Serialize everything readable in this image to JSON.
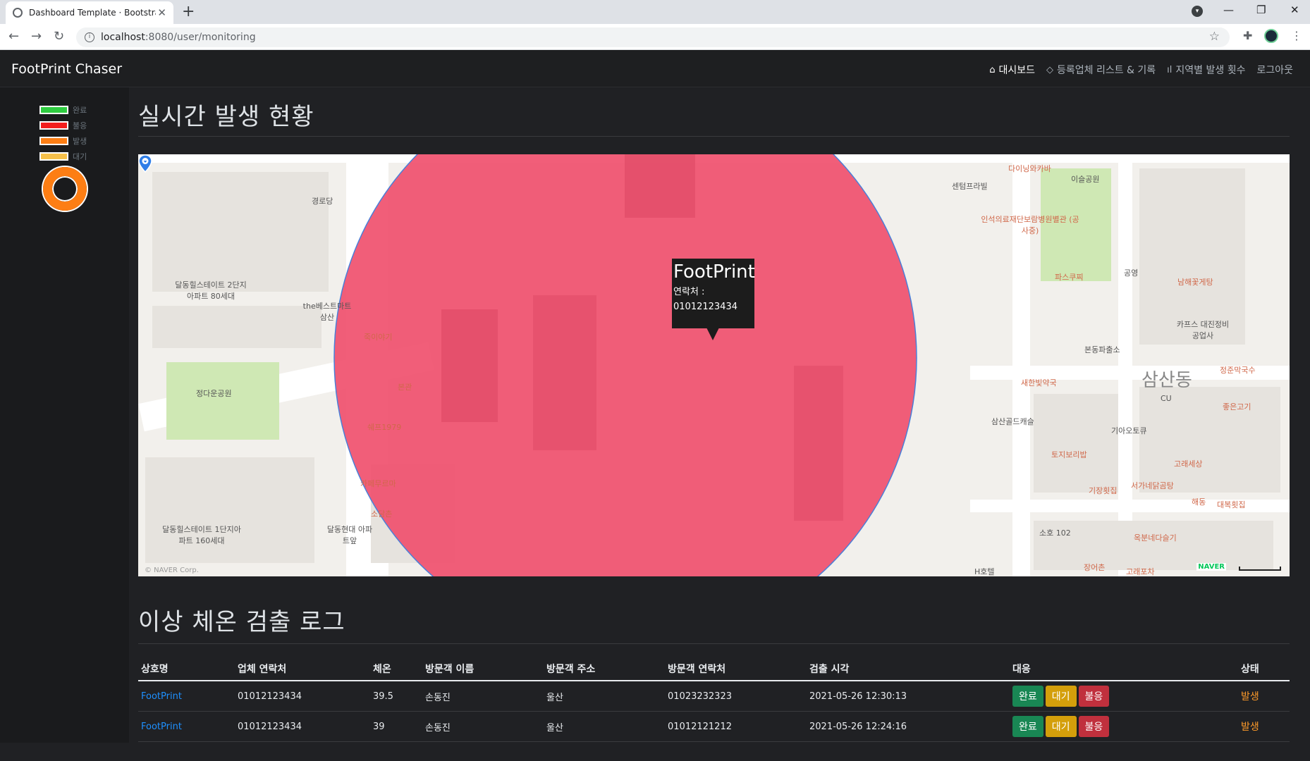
{
  "browser": {
    "tab_title": "Dashboard Template · Bootstrap",
    "url_host": "localhost",
    "url_rest": ":8080/user/monitoring"
  },
  "navbar": {
    "brand": "FootPrint Chaser",
    "links": [
      {
        "label": "대시보드",
        "icon": "home-icon"
      },
      {
        "label": "등록업체 리스트 & 기록",
        "icon": "layers-icon"
      },
      {
        "label": "지역별 발생 횟수",
        "icon": "bar-chart-icon"
      },
      {
        "label": "로그아웃",
        "icon": ""
      }
    ]
  },
  "sidebar": {
    "legend": [
      {
        "label": "완료",
        "color": "#2ecc40"
      },
      {
        "label": "불응",
        "color": "#f21d1d"
      },
      {
        "label": "발생",
        "color": "#fd7e14"
      },
      {
        "label": "대기",
        "color": "#f5c04a"
      }
    ]
  },
  "realtime": {
    "title": "실시간 발생 현황",
    "info_window": {
      "name": "FootPrint",
      "contact_label": "연락처 :",
      "phone": "01012123434"
    },
    "map_copyright": "© NAVER Corp.",
    "map_logo": "NAVER",
    "map_labels": [
      {
        "text": "경로당",
        "kind": "normal"
      },
      {
        "text": "달동힐스테이트 2단지아파트 80세대",
        "kind": "normal"
      },
      {
        "text": "정다운공원",
        "kind": "normal"
      },
      {
        "text": "달동힐스테이트 1단지아파트 160세대",
        "kind": "normal"
      },
      {
        "text": "달동현대 아파트앞",
        "kind": "normal"
      },
      {
        "text": "the베스트마트 삼산",
        "kind": "normal"
      },
      {
        "text": "죽이야기",
        "kind": "poi"
      },
      {
        "text": "본관",
        "kind": "poi"
      },
      {
        "text": "쉐프1979",
        "kind": "poi"
      },
      {
        "text": "카페무르마",
        "kind": "poi"
      },
      {
        "text": "소담촌",
        "kind": "poi"
      },
      {
        "text": "센텀프라빌",
        "kind": "normal"
      },
      {
        "text": "다이닝와카바",
        "kind": "poi"
      },
      {
        "text": "이슬공원",
        "kind": "normal"
      },
      {
        "text": "인석의료재단보람병원별관 (공사중)",
        "kind": "poi"
      },
      {
        "text": "파스쿠찌",
        "kind": "poi"
      },
      {
        "text": "공영",
        "kind": "normal"
      },
      {
        "text": "남해꽃게탕",
        "kind": "poi"
      },
      {
        "text": "카프스 대진정비공업사",
        "kind": "normal"
      },
      {
        "text": "본동파출소",
        "kind": "normal"
      },
      {
        "text": "정준막국수",
        "kind": "poi"
      },
      {
        "text": "새한빛약국",
        "kind": "poi"
      },
      {
        "text": "삼산동",
        "kind": "big"
      },
      {
        "text": "CU",
        "kind": "normal"
      },
      {
        "text": "좋은고기",
        "kind": "poi"
      },
      {
        "text": "삼산골드캐슬",
        "kind": "normal"
      },
      {
        "text": "기아오토큐",
        "kind": "normal"
      },
      {
        "text": "토지보리밥",
        "kind": "poi"
      },
      {
        "text": "고래세상",
        "kind": "poi"
      },
      {
        "text": "기장횟집",
        "kind": "poi"
      },
      {
        "text": "서가네닭곰탕",
        "kind": "poi"
      },
      {
        "text": "해동",
        "kind": "poi"
      },
      {
        "text": "대복횟집",
        "kind": "poi"
      },
      {
        "text": "소호 102",
        "kind": "normal"
      },
      {
        "text": "옥분네다슬기",
        "kind": "poi"
      },
      {
        "text": "장어촌",
        "kind": "poi"
      },
      {
        "text": "고래포차",
        "kind": "poi"
      },
      {
        "text": "H호텔",
        "kind": "normal"
      }
    ]
  },
  "log": {
    "title": "이상 체온 검출 로그",
    "columns": [
      "상호명",
      "업체 연락처",
      "체온",
      "방문객 이름",
      "방문객 주소",
      "방문객 연락처",
      "검출 시각",
      "대응",
      "상태"
    ],
    "actions": {
      "done": "완료",
      "wait": "대기",
      "reject": "불응"
    },
    "rows": [
      {
        "store": "FootPrint",
        "store_phone": "01012123434",
        "temp": "39.5",
        "visitor": "손동진",
        "address": "울산",
        "visitor_phone": "01023232323",
        "time": "2021-05-26 12:30:13",
        "status": "발생"
      },
      {
        "store": "FootPrint",
        "store_phone": "01012123434",
        "temp": "39",
        "visitor": "손동진",
        "address": "울산",
        "visitor_phone": "01012121212",
        "time": "2021-05-26 12:24:16",
        "status": "발생"
      }
    ]
  }
}
